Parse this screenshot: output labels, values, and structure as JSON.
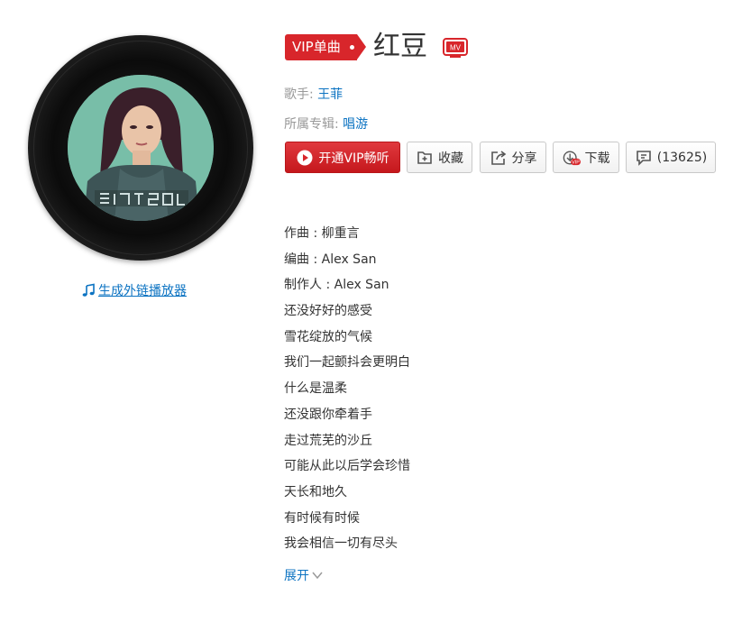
{
  "player": {
    "cover_alt": "album-cover",
    "external_player_link": "生成外链播放器"
  },
  "song": {
    "badge": "VIP单曲",
    "title": "红豆",
    "mv_label": "MV",
    "artist_label": "歌手:",
    "artist": "王菲",
    "album_label": "所属专辑:",
    "album": "唱游"
  },
  "actions": {
    "play_vip": "开通VIP畅听",
    "favorite": "收藏",
    "share": "分享",
    "download": "下载",
    "download_badge": "VIP",
    "comments": "(13625)"
  },
  "lyrics": {
    "lines": [
      "作曲 : 柳重言",
      "编曲 : Alex San",
      "制作人 : Alex San",
      "还没好好的感受",
      "雪花绽放的气候",
      "我们一起颤抖会更明白",
      "什么是温柔",
      "还没跟你牵着手",
      "走过荒芜的沙丘",
      "可能从此以后学会珍惜",
      "天长和地久",
      "有时候有时候",
      "我会相信一切有尽头"
    ],
    "expand": "展开"
  },
  "colors": {
    "accent_red": "#d8262b",
    "link_blue": "#0c73c2",
    "text_gray": "#999999"
  }
}
